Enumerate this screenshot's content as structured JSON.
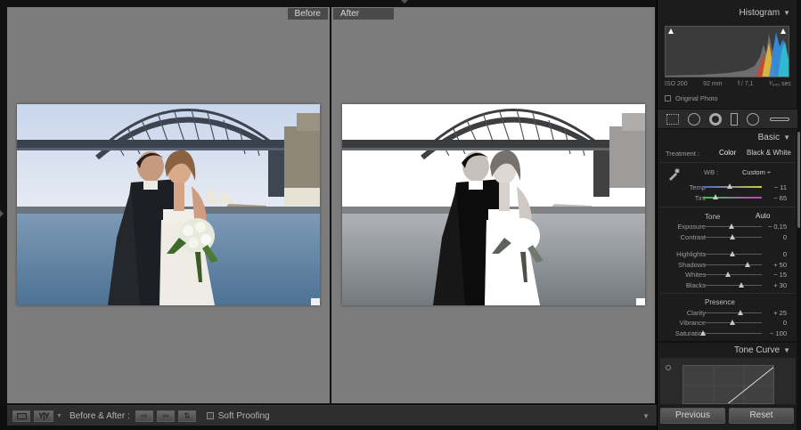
{
  "compare": {
    "before_label": "Before",
    "after_label": "After"
  },
  "toolbar": {
    "before_after_label": "Before & After :",
    "soft_proofing_label": "Soft Proofing",
    "soft_proofing_checked": false
  },
  "panel": {
    "histogram": {
      "title": "Histogram",
      "iso": "ISO 200",
      "focal_length": "92 mm",
      "aperture": "f / 7,1",
      "shutter": "¹⁄₆₄₀ sec",
      "original_photo_label": "Original Photo"
    },
    "tools": [
      "crop-overlay-icon",
      "spot-removal-icon",
      "red-eye-icon",
      "graduated-filter-icon",
      "radial-filter-icon",
      "adjustment-brush-icon"
    ],
    "basic": {
      "title": "Basic",
      "treatment_label": "Treatment :",
      "treatment_color": "Color",
      "treatment_bw": "Black & White",
      "treatment_selected": "Color",
      "wb_label": "WB :",
      "wb_value": "Custom ÷",
      "tone_label": "Tone",
      "auto_label": "Auto",
      "presence_label": "Presence",
      "sliders": {
        "temp": {
          "label": "Temp",
          "value": "− 11",
          "level": 0.46
        },
        "tint": {
          "label": "Tint",
          "value": "− 65",
          "level": 0.21
        },
        "exposure": {
          "label": "Exposure",
          "value": "− 0,15",
          "level": 0.48
        },
        "contrast": {
          "label": "Contrast",
          "value": "0",
          "level": 0.5
        },
        "highlights": {
          "label": "Highlights",
          "value": "0",
          "level": 0.5
        },
        "shadows": {
          "label": "Shadows",
          "value": "+ 50",
          "level": 0.75
        },
        "whites": {
          "label": "Whites",
          "value": "− 15",
          "level": 0.43
        },
        "blacks": {
          "label": "Blacks",
          "value": "+ 30",
          "level": 0.65
        },
        "clarity": {
          "label": "Clarity",
          "value": "+ 25",
          "level": 0.63
        },
        "vibrance": {
          "label": "Vibrance",
          "value": "0",
          "level": 0.5
        },
        "saturation": {
          "label": "Saturation",
          "value": "− 100",
          "level": 0.0
        }
      }
    },
    "tone_curve": {
      "title": "Tone Curve"
    },
    "previous_label": "Previous",
    "reset_label": "Reset"
  }
}
